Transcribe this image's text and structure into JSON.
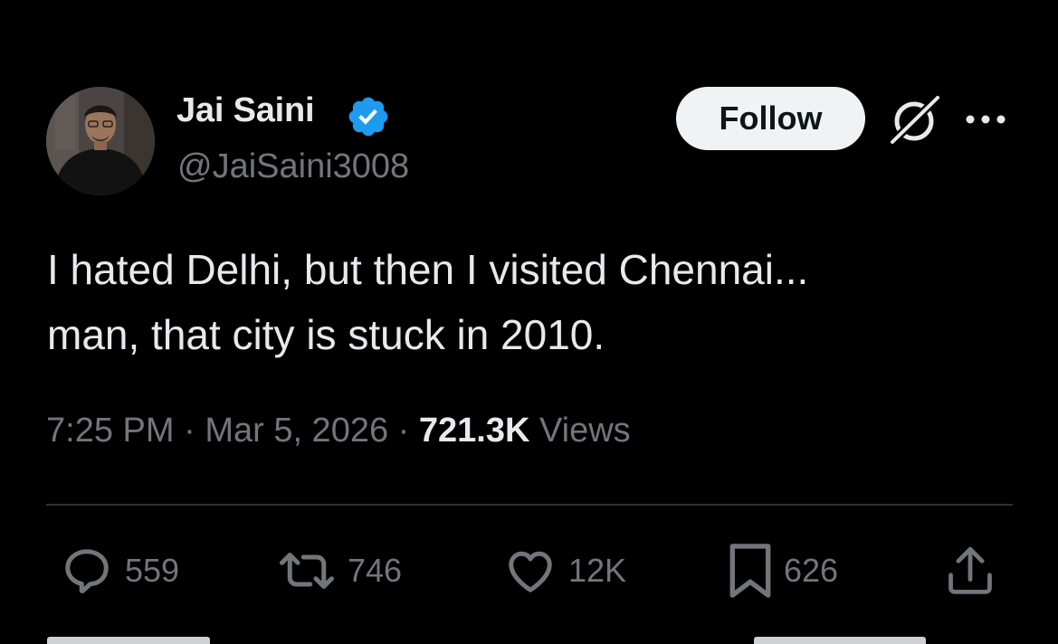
{
  "author": {
    "display_name": "Jai Saini",
    "handle": "@JaiSaini3008",
    "verified_color": "#1d9bf0"
  },
  "header": {
    "follow_label": "Follow",
    "grok_icon": "grok-icon",
    "more_icon": "more-icon"
  },
  "tweet": {
    "lines": [
      "I hated Delhi, but then I visited Chennai...",
      "man, that city is stuck in 2010."
    ],
    "time": "7:25 PM",
    "date": "Mar 5, 2026",
    "separator": "·",
    "views_count": "721.3K",
    "views_label": "Views"
  },
  "actions": {
    "reply_count": "559",
    "retweet_count": "746",
    "like_count": "12K",
    "bookmark_count": "626"
  },
  "colors": {
    "background": "#000000",
    "primary_text": "#e7e9ea",
    "secondary_text": "#71767b",
    "divider": "#2f3336",
    "follow_bg": "#eff3f4",
    "follow_text": "#0f1419"
  }
}
